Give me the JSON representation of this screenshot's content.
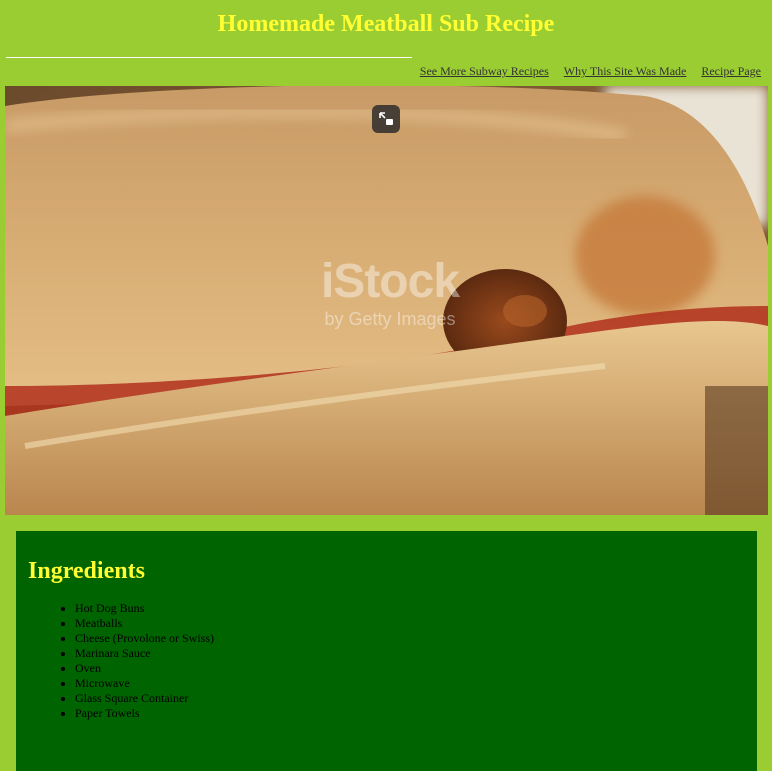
{
  "page": {
    "title": "Homemade Meatball Sub Recipe",
    "colors": {
      "background": "#9acd32",
      "title": "#ffff33",
      "card": "#006400",
      "nav_link": "#333333"
    }
  },
  "nav": {
    "links": [
      {
        "label": "See More Subway Recipes"
      },
      {
        "label": "Why This Site Was Made"
      },
      {
        "label": "Recipe Page"
      }
    ]
  },
  "hero": {
    "description": "meatball sub sandwich photo",
    "watermark": {
      "main": "iStock",
      "sub": "by Getty Images"
    },
    "expand_icon": "expand-icon"
  },
  "ingredients": {
    "heading": "Ingredients",
    "items": [
      "Hot Dog Buns",
      "Meatballs",
      "Cheese (Provolone or Swiss)",
      "Marinara Sauce",
      "Oven",
      "Microwave",
      "Glass Square Container",
      "Paper Towels"
    ]
  }
}
